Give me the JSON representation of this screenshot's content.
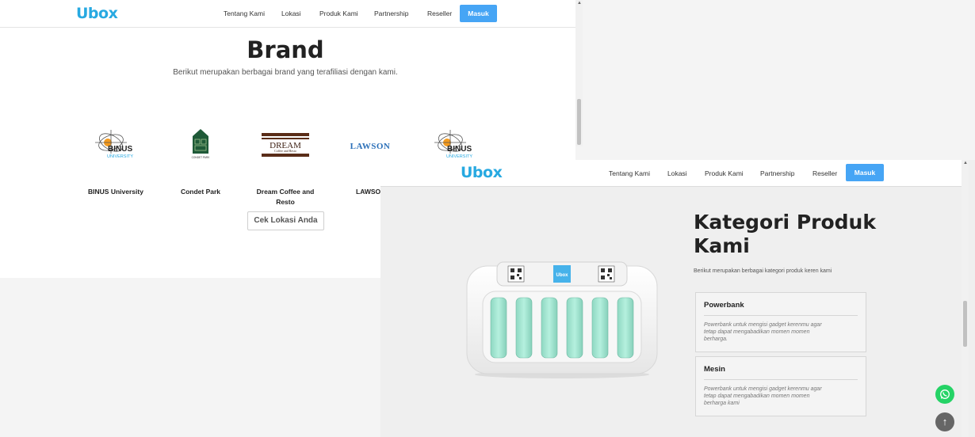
{
  "brand_logo_text": "Ubox",
  "colors": {
    "accent": "#46a5f5",
    "logo": "#27a9e1",
    "mint": "#9fe3cf",
    "whatsapp": "#25d366"
  },
  "back_window": {
    "nav": {
      "items": [
        "Tentang Kami",
        "Lokasi",
        "Produk Kami",
        "Partnership",
        "Reseller"
      ],
      "login": "Masuk"
    },
    "section_title": "Brand",
    "section_subtitle": "Berikut merupakan berbagai brand yang terafiliasi dengan kami.",
    "brands": [
      {
        "name": "BINUS University",
        "logo": "binus-logo",
        "logo_text": "BINUS",
        "logo_sub": "UNIVERSITY"
      },
      {
        "name": "Condet Park",
        "logo": "condet-park-logo",
        "logo_text": "CONDET PARK"
      },
      {
        "name": "Dream Coffee and Resto",
        "logo": "dream-coffee-logo",
        "logo_text": "DREAM",
        "logo_sub": "Coffee and Resto"
      },
      {
        "name": "LAWSO",
        "logo": "lawson-logo",
        "logo_text": "LAWSON"
      },
      {
        "name": "",
        "logo": "binus-logo",
        "logo_text": "BINUS",
        "logo_sub": "UNIVERSITY"
      }
    ],
    "cta_button": "Cek Lokasi Anda"
  },
  "front_window": {
    "nav": {
      "items": [
        "Tentang Kami",
        "Lokasi",
        "Produk Kami",
        "Partnership",
        "Reseller"
      ],
      "login": "Masuk"
    },
    "section_title": "Kategori Produk Kami",
    "section_subtitle": "Berikut merupakan berbagai kategori produk keren kami",
    "product_image_label": "Ubox",
    "categories": [
      {
        "title": "Powerbank",
        "desc": "Powerbank untuk mengisi gadget kerenmu agar tetap dapat mengabadikan momen momen berharga."
      },
      {
        "title": "Mesin",
        "desc": "Powerbank untuk mengisi gadget kerenmu agar tetap dapat mengabadikan momen momen berharga kami"
      }
    ]
  },
  "floating": {
    "whatsapp_icon": "whatsapp-icon",
    "scroll_top_icon": "arrow-up-icon"
  }
}
